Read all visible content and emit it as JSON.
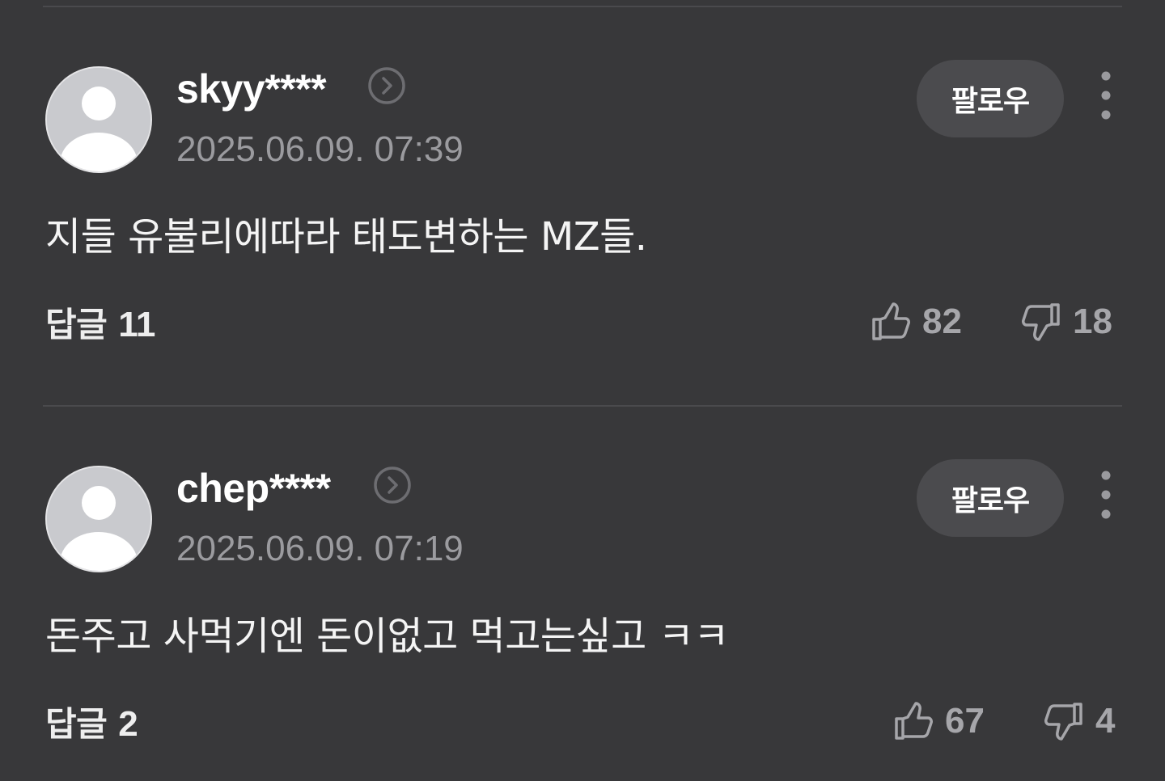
{
  "comments": [
    {
      "username": "skyy****",
      "timestamp": "2025.06.09. 07:39",
      "follow_label": "팔로우",
      "text": "지들 유불리에따라 태도변하는 MZ들.",
      "reply_label": "답글",
      "reply_count": "11",
      "likes": "82",
      "dislikes": "18"
    },
    {
      "username": "chep****",
      "timestamp": "2025.06.09. 07:19",
      "follow_label": "팔로우",
      "text": "돈주고 사먹기엔 돈이없고 먹고는싶고 ㅋㅋ",
      "reply_label": "답글",
      "reply_count": "2",
      "likes": "67",
      "dislikes": "4"
    }
  ],
  "icons": {
    "profile_link": "chevron-right-circle-icon",
    "more": "more-vertical-icon",
    "like": "thumbs-up-icon",
    "dislike": "thumbs-down-icon",
    "avatar": "default-avatar-icon"
  },
  "colors": {
    "background": "#38383a",
    "follow_button": "#4b4b4e",
    "secondary_text": "#9b9b9f",
    "divider": "#4a4a4d"
  }
}
